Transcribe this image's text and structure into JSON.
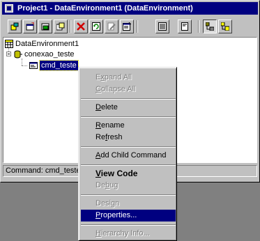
{
  "window": {
    "title": "Project1 - DataEnvironment1 (DataEnvironment)"
  },
  "toolbar": {
    "buttons": [
      {
        "icon": "add-connection-icon"
      },
      {
        "icon": "add-command-icon"
      },
      {
        "icon": "add-child-command-icon"
      },
      {
        "icon": "add-command-copy-icon"
      },
      {
        "icon": "delete-icon"
      },
      {
        "icon": "refresh-icon"
      },
      {
        "icon": "design-icon"
      },
      {
        "icon": "properties-icon"
      },
      {
        "icon": "view-code-icon"
      },
      {
        "icon": "hierarchy-info-icon"
      },
      {
        "icon": "sort-by-connection-icon"
      },
      {
        "icon": "sort-by-object-icon"
      }
    ]
  },
  "tree": {
    "root": "DataEnvironment1",
    "connection": "conexao_teste",
    "command": "cmd_teste"
  },
  "status": {
    "label": "Command:",
    "value": "cmd_teste"
  },
  "context_menu": {
    "items": {
      "expand_all": {
        "pre": "E",
        "u": "x",
        "post": "pand All"
      },
      "collapse_all": {
        "pre": "",
        "u": "C",
        "post": "ollapse All"
      },
      "delete": {
        "pre": "",
        "u": "D",
        "post": "elete"
      },
      "rename": {
        "pre": "",
        "u": "R",
        "post": "ename"
      },
      "refresh": {
        "pre": "Re",
        "u": "f",
        "post": "resh"
      },
      "add_child_command": {
        "pre": "",
        "u": "A",
        "post": "dd Child Command"
      },
      "view_code": {
        "pre": "",
        "u": "V",
        "post": "iew Code"
      },
      "debug": {
        "pre": "De",
        "u": "b",
        "post": "ug"
      },
      "design": {
        "pre": "Desi",
        "u": "g",
        "post": "n"
      },
      "properties": {
        "pre": "",
        "u": "P",
        "post": "roperties..."
      },
      "hierarchy_info": {
        "pre": "",
        "u": "H",
        "post": "ierarchy Info..."
      }
    }
  },
  "colors": {
    "title_bar": "#000080",
    "face": "#c0c0c0",
    "highlight": "#000080",
    "desktop": "#808080"
  }
}
